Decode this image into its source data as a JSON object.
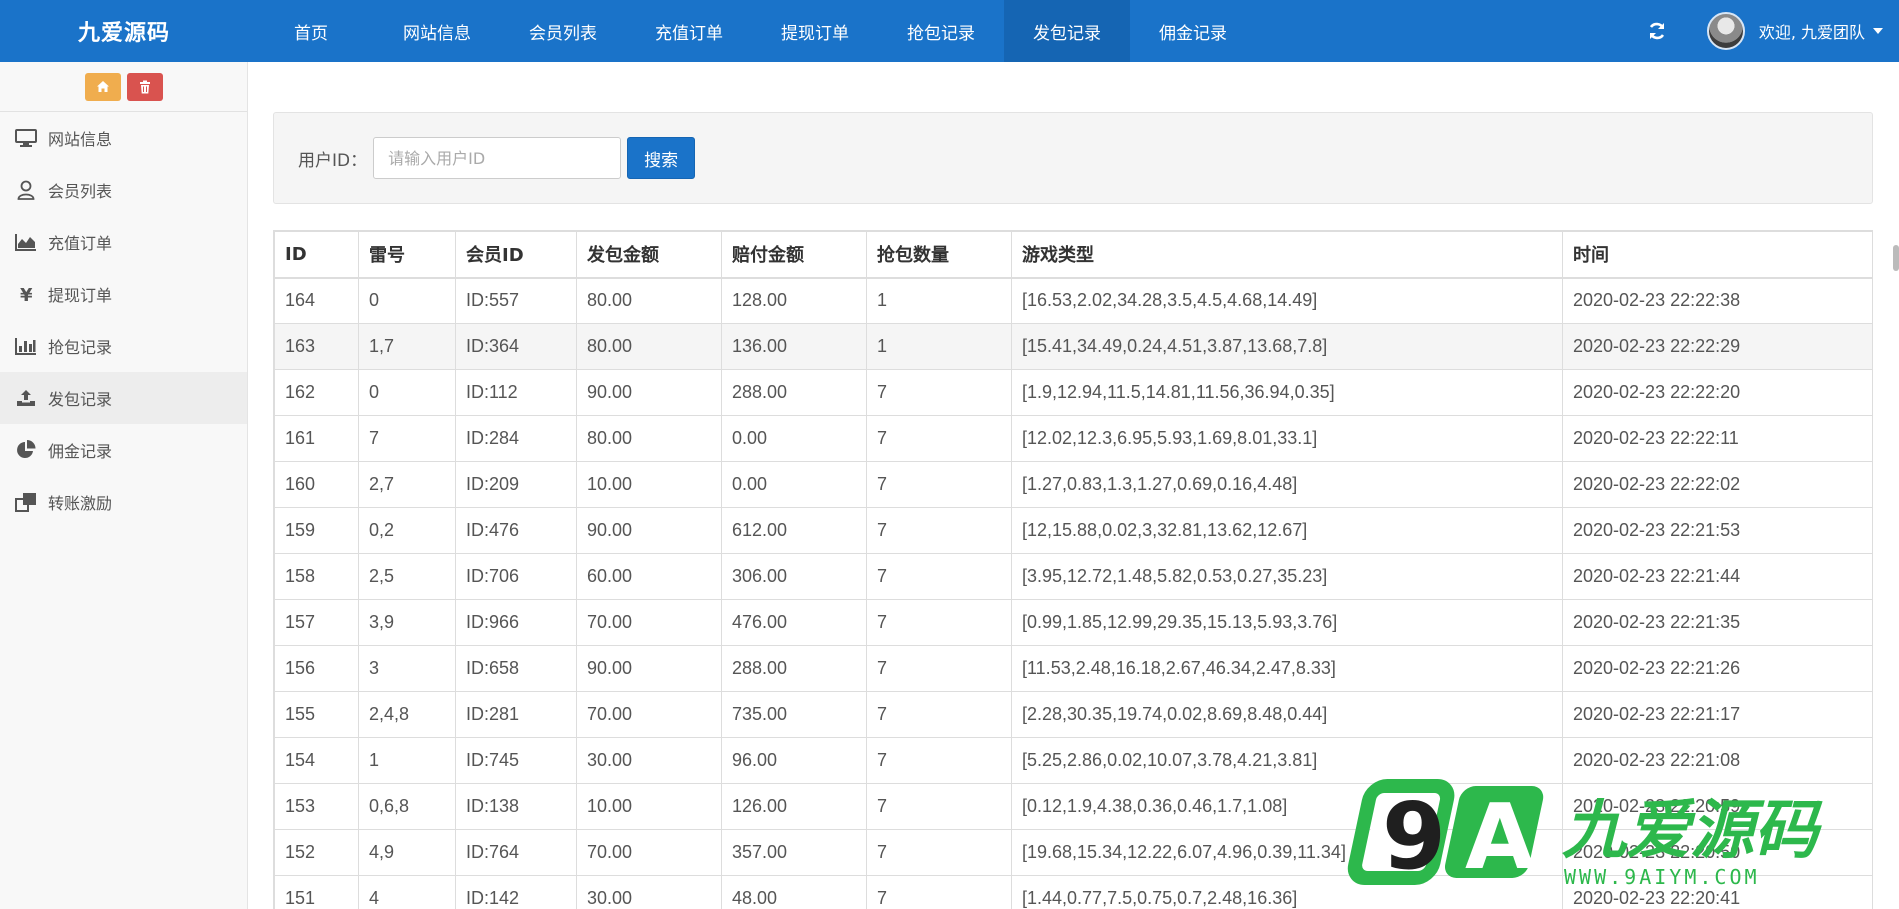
{
  "brand": "九爱源码",
  "nav": [
    {
      "label": "首页"
    },
    {
      "label": "网站信息"
    },
    {
      "label": "会员列表"
    },
    {
      "label": "充值订单"
    },
    {
      "label": "提现订单"
    },
    {
      "label": "抢包记录"
    },
    {
      "label": "发包记录",
      "active": true
    },
    {
      "label": "佣金记录"
    }
  ],
  "user": {
    "welcome": "欢迎, 九爱团队"
  },
  "sidebar": {
    "items": [
      {
        "label": "网站信息",
        "icon": "monitor-icon"
      },
      {
        "label": "会员列表",
        "icon": "user-icon"
      },
      {
        "label": "充值订单",
        "icon": "area-chart-icon"
      },
      {
        "label": "提现订单",
        "icon": "yen-icon"
      },
      {
        "label": "抢包记录",
        "icon": "bar-chart-icon"
      },
      {
        "label": "发包记录",
        "icon": "upload-icon",
        "active": true
      },
      {
        "label": "佣金记录",
        "icon": "pie-chart-icon"
      },
      {
        "label": "转账激励",
        "icon": "clone-icon"
      }
    ]
  },
  "search": {
    "label": "用户ID：",
    "placeholder": "请输入用户ID",
    "value": "",
    "button": "搜索"
  },
  "table": {
    "headers": [
      "ID",
      "雷号",
      "会员ID",
      "发包金额",
      "赔付金额",
      "抢包数量",
      "游戏类型",
      "时间"
    ],
    "rows": [
      [
        "164",
        "0",
        "ID:557",
        "80.00",
        "128.00",
        "1",
        "[16.53,2.02,34.28,3.5,4.5,4.68,14.49]",
        "2020-02-23 22:22:38"
      ],
      [
        "163",
        "1,7",
        "ID:364",
        "80.00",
        "136.00",
        "1",
        "[15.41,34.49,0.24,4.51,3.87,13.68,7.8]",
        "2020-02-23 22:22:29"
      ],
      [
        "162",
        "0",
        "ID:112",
        "90.00",
        "288.00",
        "7",
        "[1.9,12.94,11.5,14.81,11.56,36.94,0.35]",
        "2020-02-23 22:22:20"
      ],
      [
        "161",
        "7",
        "ID:284",
        "80.00",
        "0.00",
        "7",
        "[12.02,12.3,6.95,5.93,1.69,8.01,33.1]",
        "2020-02-23 22:22:11"
      ],
      [
        "160",
        "2,7",
        "ID:209",
        "10.00",
        "0.00",
        "7",
        "[1.27,0.83,1.3,1.27,0.69,0.16,4.48]",
        "2020-02-23 22:22:02"
      ],
      [
        "159",
        "0,2",
        "ID:476",
        "90.00",
        "612.00",
        "7",
        "[12,15.88,0.02,3,32.81,13.62,12.67]",
        "2020-02-23 22:21:53"
      ],
      [
        "158",
        "2,5",
        "ID:706",
        "60.00",
        "306.00",
        "7",
        "[3.95,12.72,1.48,5.82,0.53,0.27,35.23]",
        "2020-02-23 22:21:44"
      ],
      [
        "157",
        "3,9",
        "ID:966",
        "70.00",
        "476.00",
        "7",
        "[0.99,1.85,12.99,29.35,15.13,5.93,3.76]",
        "2020-02-23 22:21:35"
      ],
      [
        "156",
        "3",
        "ID:658",
        "90.00",
        "288.00",
        "7",
        "[11.53,2.48,16.18,2.67,46.34,2.47,8.33]",
        "2020-02-23 22:21:26"
      ],
      [
        "155",
        "2,4,8",
        "ID:281",
        "70.00",
        "735.00",
        "7",
        "[2.28,30.35,19.74,0.02,8.69,8.48,0.44]",
        "2020-02-23 22:21:17"
      ],
      [
        "154",
        "1",
        "ID:745",
        "30.00",
        "96.00",
        "7",
        "[5.25,2.86,0.02,10.07,3.78,4.21,3.81]",
        "2020-02-23 22:21:08"
      ],
      [
        "153",
        "0,6,8",
        "ID:138",
        "10.00",
        "126.00",
        "7",
        "[0.12,1.9,4.38,0.36,0.46,1.7,1.08]",
        "2020-02-23 22:20:59"
      ],
      [
        "152",
        "4,9",
        "ID:764",
        "70.00",
        "357.00",
        "7",
        "[19.68,15.34,12.22,6.07,4.96,0.39,11.34]",
        "2020-02-23 22:20:50"
      ],
      [
        "151",
        "4",
        "ID:142",
        "30.00",
        "48.00",
        "7",
        "[1.44,0.77,7.5,0.75,0.7,2.48,16.36]",
        "2020-02-23 22:20:41"
      ]
    ]
  },
  "watermark": {
    "logo": "9A",
    "name": "九爱源码",
    "url": "WWW.9AIYM.COM"
  },
  "colors": {
    "primary": "#1a73c9",
    "watermark_green": "#2db84c"
  }
}
